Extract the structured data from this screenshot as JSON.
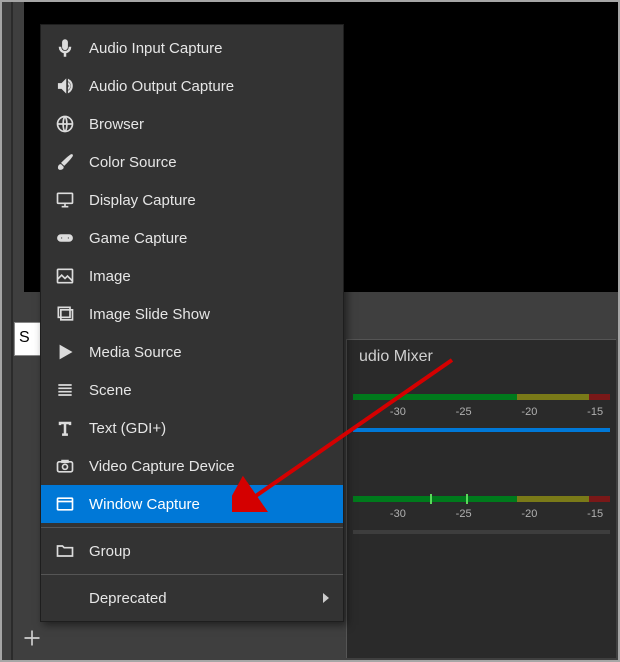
{
  "tab_partial": "S",
  "mixer": {
    "title_fragment": "udio Mixer",
    "tick_labels": [
      "-30",
      "-25",
      "-20",
      "-15"
    ]
  },
  "menu": {
    "items": [
      {
        "id": "audio-input-capture",
        "label": "Audio Input Capture"
      },
      {
        "id": "audio-output-capture",
        "label": "Audio Output Capture"
      },
      {
        "id": "browser",
        "label": "Browser"
      },
      {
        "id": "color-source",
        "label": "Color Source"
      },
      {
        "id": "display-capture",
        "label": "Display Capture"
      },
      {
        "id": "game-capture",
        "label": "Game Capture"
      },
      {
        "id": "image",
        "label": "Image"
      },
      {
        "id": "image-slide-show",
        "label": "Image Slide Show"
      },
      {
        "id": "media-source",
        "label": "Media Source"
      },
      {
        "id": "scene",
        "label": "Scene"
      },
      {
        "id": "text-gdi",
        "label": "Text (GDI+)"
      },
      {
        "id": "video-capture-device",
        "label": "Video Capture Device"
      },
      {
        "id": "window-capture",
        "label": "Window Capture",
        "selected": true
      }
    ],
    "group_label": "Group",
    "deprecated_label": "Deprecated"
  }
}
